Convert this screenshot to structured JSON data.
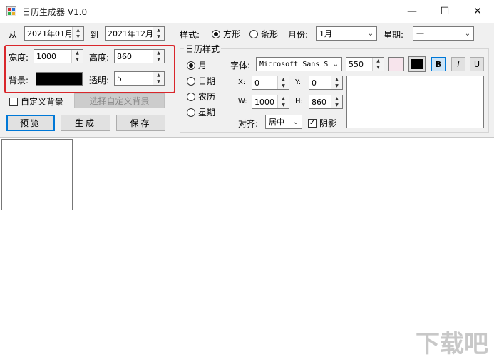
{
  "window": {
    "title": "日历生成器 V1.0",
    "minimize_icon": "minimize-icon",
    "maximize_icon": "maximize-icon",
    "close_icon": "close-icon"
  },
  "range": {
    "from_label": "从",
    "from_value": "2021年01月",
    "to_label": "到",
    "to_value": "2021年12月"
  },
  "style": {
    "label": "样式:",
    "option_square": "方形",
    "option_strip": "条形",
    "selected": "方形"
  },
  "month": {
    "label": "月份:",
    "value": "1月"
  },
  "weekday": {
    "label": "星期:",
    "value": "一"
  },
  "size": {
    "width_label": "宽度:",
    "width_value": "1000",
    "height_label": "高度:",
    "height_value": "860",
    "bg_label": "背景:",
    "bg_color": "#000000",
    "opacity_label": "透明:",
    "opacity_value": "5"
  },
  "custom_bg": {
    "checkbox_label": "自定义背景",
    "checked": false,
    "select_button": "选择自定义背景"
  },
  "actions": {
    "preview": "预览",
    "generate": "生成",
    "save": "保存"
  },
  "calendar_style": {
    "title": "日历样式",
    "options": [
      "月",
      "日期",
      "农历",
      "星期"
    ],
    "selected": "月"
  },
  "font": {
    "label": "字体:",
    "family": "Microsoft Sans S",
    "size": "550",
    "color_swatch_1": "#f7e4ec",
    "color_swatch_2": "#000000",
    "bold": "B",
    "italic": "I",
    "underline": "U"
  },
  "position": {
    "x_label": "X:",
    "x_value": "0",
    "y_label": "Y:",
    "y_value": "0",
    "w_label": "W:",
    "w_value": "1000",
    "h_label": "H:",
    "h_value": "860"
  },
  "align": {
    "label": "对齐:",
    "value": "居中"
  },
  "shadow": {
    "label": "阴影",
    "checked": true
  },
  "watermark": "下载吧",
  "colors": {
    "accent": "#0078d7",
    "highlight": "#d9262b",
    "panel": "#f0f0f0"
  }
}
